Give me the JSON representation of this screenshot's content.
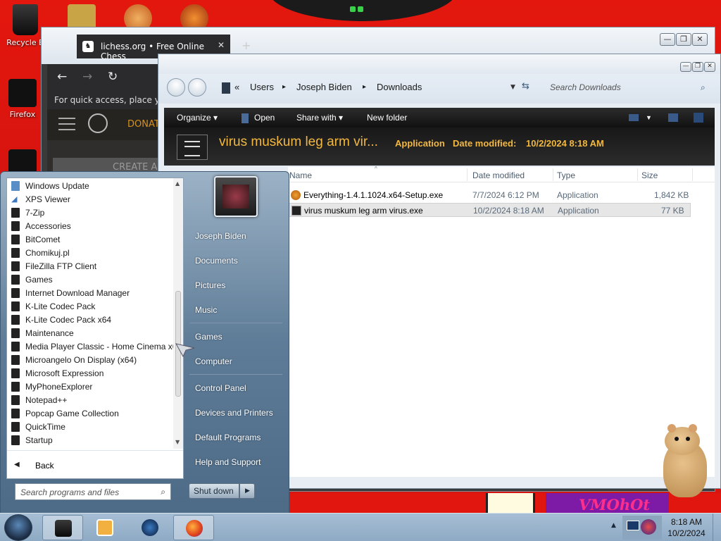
{
  "desktop": {
    "icons": [
      {
        "label": "Recycle B",
        "icon": "recycle-bin-icon"
      },
      {
        "label": "Firefox",
        "icon": "firefox-icon"
      }
    ],
    "watermark": "VMOhOt"
  },
  "browser": {
    "tab_title": "lichess.org • Free Online Chess",
    "tab_close": "✕",
    "new_tab": "+",
    "back": "←",
    "forward": "→",
    "reload": "↻",
    "quick_access_text": "For quick access, place your",
    "donate": "DONAT",
    "create_button": "CREATE A",
    "controls": {
      "minimize": "—",
      "maximize": "❐",
      "close": "✕"
    }
  },
  "explorer": {
    "breadcrumb": {
      "overflow": "«",
      "parts": [
        "Users",
        "Joseph Biden",
        "Downloads"
      ],
      "separator": "▸"
    },
    "search_placeholder": "Search Downloads",
    "toolbar": {
      "organize": "Organize",
      "open": "Open",
      "share_with": "Share with",
      "new_folder": "New folder"
    },
    "details": {
      "name": "virus muskum leg arm vir...",
      "type": "Application",
      "date_label": "Date modified:",
      "date": "10/2/2024 8:18 AM"
    },
    "columns": [
      "Name",
      "Date modified",
      "Type",
      "Size"
    ],
    "files": [
      {
        "name": "Everything-1.4.1.1024.x64-Setup.exe",
        "date": "7/7/2024 6:12 PM",
        "type": "Application",
        "size": "1,842 KB",
        "icon": "setup-installer-icon",
        "selected": false
      },
      {
        "name": "virus muskum leg arm virus.exe",
        "date": "10/2/2024 8:18 AM",
        "type": "Application",
        "size": "77 KB",
        "icon": "application-icon",
        "selected": true
      }
    ],
    "controls": {
      "minimize": "—",
      "maximize": "❐",
      "close": "✕"
    }
  },
  "start_menu": {
    "programs": [
      {
        "label": "Windows Update",
        "icon": "windows-update-icon"
      },
      {
        "label": "XPS Viewer",
        "icon": "xps-viewer-icon"
      },
      {
        "label": "7-Zip",
        "icon": "folder-icon"
      },
      {
        "label": "Accessories",
        "icon": "folder-icon"
      },
      {
        "label": "BitComet",
        "icon": "folder-icon"
      },
      {
        "label": "Chomikuj.pl",
        "icon": "folder-icon"
      },
      {
        "label": "FileZilla FTP Client",
        "icon": "folder-icon"
      },
      {
        "label": "Games",
        "icon": "folder-icon"
      },
      {
        "label": "Internet Download Manager",
        "icon": "folder-icon"
      },
      {
        "label": "K-Lite Codec Pack",
        "icon": "folder-icon"
      },
      {
        "label": "K-Lite Codec Pack x64",
        "icon": "folder-icon"
      },
      {
        "label": "Maintenance",
        "icon": "folder-icon"
      },
      {
        "label": "Media Player Classic - Home Cinema x6",
        "icon": "folder-icon"
      },
      {
        "label": "Microangelo On Display (x64)",
        "icon": "folder-icon"
      },
      {
        "label": "Microsoft Expression",
        "icon": "folder-icon"
      },
      {
        "label": "MyPhoneExplorer",
        "icon": "folder-icon"
      },
      {
        "label": "Notepad++",
        "icon": "folder-icon"
      },
      {
        "label": "Popcap Game Collection",
        "icon": "folder-icon"
      },
      {
        "label": "QuickTime",
        "icon": "folder-icon"
      },
      {
        "label": "Startup",
        "icon": "folder-icon"
      }
    ],
    "back_label": "Back",
    "search_placeholder": "Search programs and files",
    "right_links": [
      "Joseph Biden",
      "Documents",
      "Pictures",
      "Music",
      "Games",
      "Computer",
      "Control Panel",
      "Devices and Printers",
      "Default Programs",
      "Help and Support"
    ],
    "shutdown_label": "Shut down"
  },
  "taskbar": {
    "items": [
      {
        "name": "explorer",
        "icon": "dark-window-icon",
        "active": true
      },
      {
        "name": "media-player",
        "icon": "media-player-icon",
        "active": false
      },
      {
        "name": "globe",
        "icon": "globe-icon",
        "active": false
      },
      {
        "name": "firefox",
        "icon": "firefox-icon",
        "active": true
      }
    ],
    "clock_time": "8:18 AM",
    "clock_date": "10/2/2024"
  }
}
